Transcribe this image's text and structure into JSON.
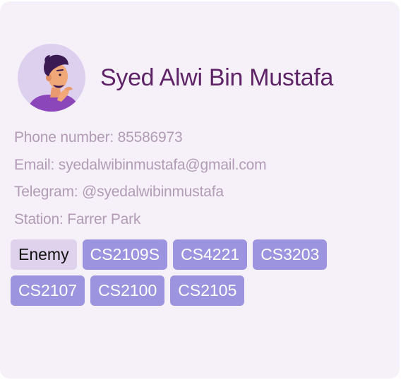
{
  "person": {
    "name": "Syed Alwi Bin Mustafa",
    "avatar_icon": "person-thinking-avatar-icon"
  },
  "details": [
    {
      "text": "Phone number: 85586973"
    },
    {
      "text": "Email: syedalwibinmustafa@gmail.com"
    },
    {
      "text": "Telegram: @syedalwibinmustafa"
    },
    {
      "text": "Station: Farrer Park"
    }
  ],
  "tags": [
    {
      "label": "Enemy",
      "kind": "relation"
    },
    {
      "label": "CS2109S",
      "kind": "module"
    },
    {
      "label": "CS4221",
      "kind": "module"
    },
    {
      "label": "CS3203",
      "kind": "module"
    },
    {
      "label": "CS2107",
      "kind": "module"
    },
    {
      "label": "CS2100",
      "kind": "module"
    },
    {
      "label": "CS2105",
      "kind": "module"
    }
  ],
  "colors": {
    "card_background": "#f6f1f9",
    "name_text": "#5e2367",
    "detail_text": "#b19bb5",
    "module_tag": "#9d94e0",
    "relation_tag": "#dfd2ec",
    "avatar_background": "#ddd0ee"
  }
}
